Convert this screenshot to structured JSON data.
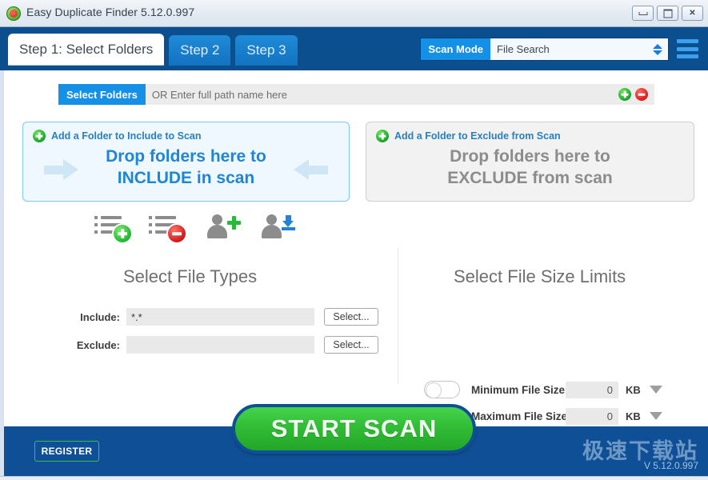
{
  "window": {
    "title": "Easy Duplicate Finder 5.12.0.997",
    "app_icon": "edf-logo-icon",
    "controls": {
      "minimize": "minimize-icon",
      "maximize": "maximize-icon",
      "close": "close-icon"
    }
  },
  "header": {
    "tabs": [
      {
        "label": "Step 1: Select Folders",
        "active": true
      },
      {
        "label": "Step 2",
        "active": false
      },
      {
        "label": "Step 3",
        "active": false
      }
    ],
    "scan_mode": {
      "label": "Scan Mode",
      "value": "File Search",
      "options": [
        "File Search"
      ]
    },
    "menu_icon": "hamburger-menu-icon",
    "bar_color": "#0c4f8f",
    "accent_color": "#1490e6"
  },
  "path_bar": {
    "button_label": "Select Folders",
    "placeholder": "OR Enter full path name here",
    "value": "",
    "add_icon": "plus-circle-icon",
    "remove_icon": "minus-circle-icon"
  },
  "drop_zones": {
    "include": {
      "add_link": "Add a Folder to Include to Scan",
      "line1": "Drop folders here to",
      "line2": "INCLUDE in scan",
      "color": "#1f86d6"
    },
    "exclude": {
      "add_link": "Add a Folder to Exclude from Scan",
      "line1": "Drop folders here to",
      "line2": "EXCLUDE from scan",
      "color": "#8c8c8c"
    }
  },
  "icon_tools": [
    {
      "name": "add-list-icon"
    },
    {
      "name": "remove-list-icon"
    },
    {
      "name": "add-profile-icon"
    },
    {
      "name": "load-profile-icon"
    }
  ],
  "file_types": {
    "title": "Select File Types",
    "include_label": "Include:",
    "include_value": "*.*",
    "exclude_label": "Exclude:",
    "exclude_value": "",
    "select_button": "Select..."
  },
  "size_limits": {
    "title": "Select File Size Limits",
    "minimum": {
      "label": "Minimum File Size",
      "value": "0",
      "unit": "KB",
      "enabled": false
    },
    "maximum": {
      "label": "Maximum File Size",
      "value": "0",
      "unit": "KB",
      "enabled": false
    }
  },
  "start_scan": {
    "label": "START  SCAN",
    "color": "#2fb833"
  },
  "footer": {
    "register_label": "REGISTER",
    "version": "V 5.12.0.997",
    "watermark": "极速下载站",
    "bar_color": "#0f4f95"
  }
}
